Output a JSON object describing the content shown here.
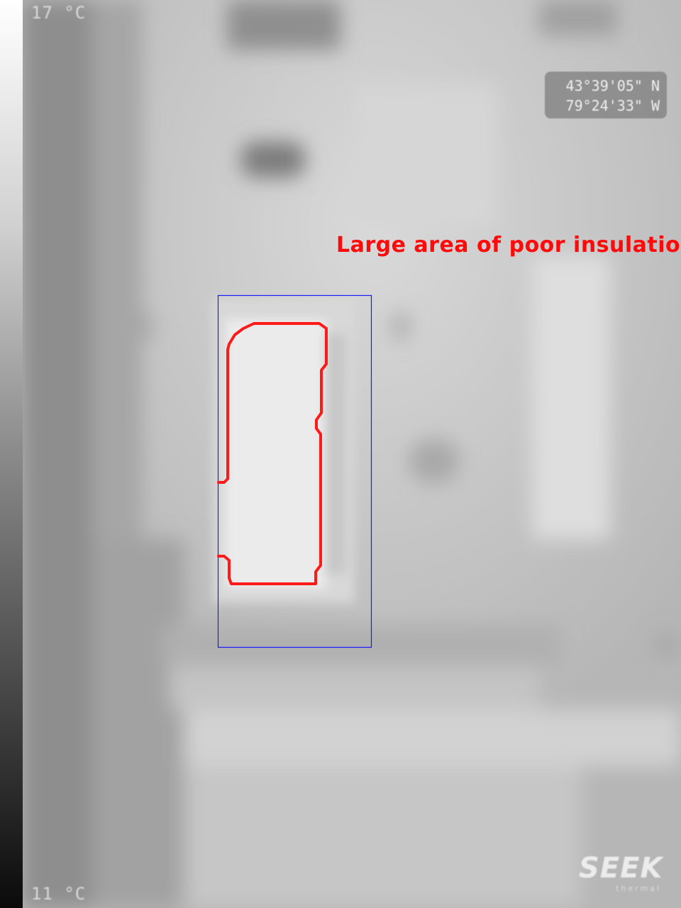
{
  "thermal_view": {
    "scale": {
      "max_label": "17 °C",
      "min_label": "11 °C"
    },
    "gps": {
      "latitude": "43°39'05\" N",
      "longitude": "79°24'33\" W"
    },
    "annotation": {
      "text": "Large area of poor insulation",
      "text_color": "#ff0a0a",
      "outline_color": "#ff1a1a",
      "box_color": "#1a1aff"
    },
    "brand": {
      "name": "SEEK",
      "subtitle": "thermal"
    }
  }
}
